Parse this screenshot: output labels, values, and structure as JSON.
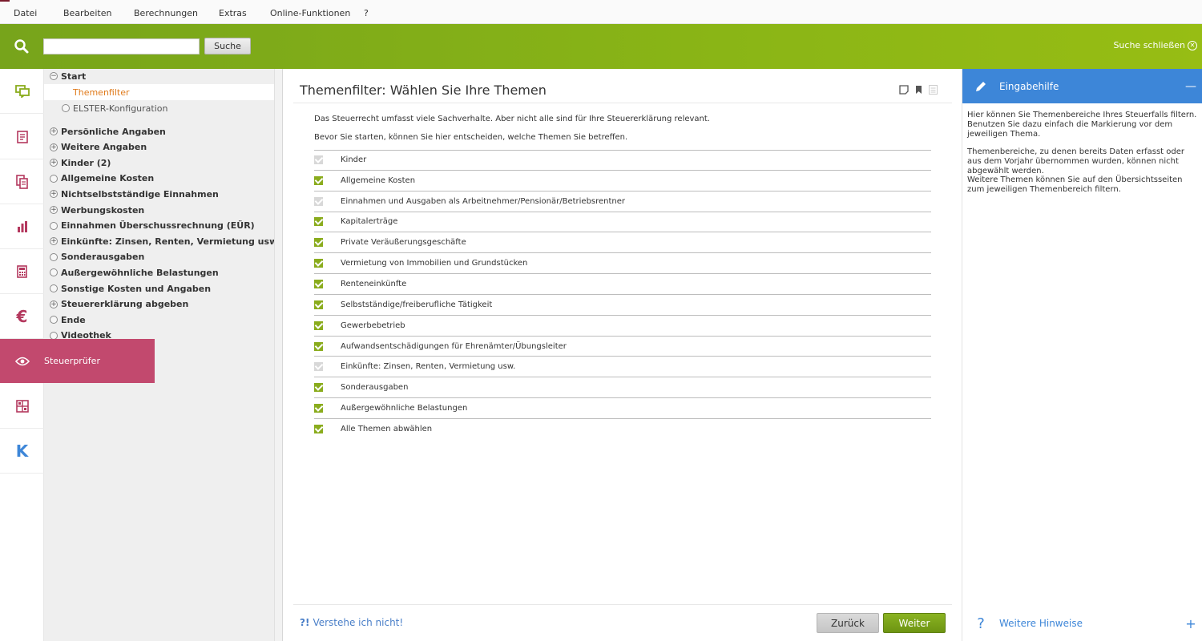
{
  "menu": [
    "Datei",
    "Bearbeiten",
    "Berechnungen",
    "Extras",
    "Online-Funktionen",
    "?"
  ],
  "search": {
    "placeholder": "",
    "button_label": "Suche",
    "close_label": "Suche schließen"
  },
  "side_icons": [
    {
      "icon": "chat-icon",
      "color": "#8aac1d"
    },
    {
      "icon": "form-icon",
      "color": "#b4385e"
    },
    {
      "icon": "documents-icon",
      "color": "#b4385e"
    },
    {
      "icon": "bar-chart-icon",
      "color": "#b4385e"
    },
    {
      "icon": "calculator-icon",
      "color": "#b4385e"
    },
    {
      "icon": "euro-icon",
      "color": "#b4385e"
    },
    {
      "icon": "eye-icon",
      "color": "#ffffff"
    },
    {
      "icon": "dashboard-icon",
      "color": "#b4385e"
    },
    {
      "icon": "k-logo-icon",
      "color": "#3d86d8"
    }
  ],
  "steuerpruefer_label": "Steuerprüfer",
  "tree": {
    "start": "Start",
    "children": [
      "Themenfilter",
      "ELSTER-Konfiguration"
    ],
    "sections": [
      {
        "label": "Persönliche Angaben",
        "sym": "+"
      },
      {
        "label": "Weitere Angaben",
        "sym": "+"
      },
      {
        "label": "Kinder (2)",
        "sym": "+"
      },
      {
        "label": "Allgemeine Kosten",
        "sym": ""
      },
      {
        "label": "Nichtselbstständige Einnahmen",
        "sym": "+"
      },
      {
        "label": "Werbungskosten",
        "sym": "+"
      },
      {
        "label": "Einnahmen Überschussrechnung (EÜR)",
        "sym": ""
      },
      {
        "label": "Einkünfte: Zinsen, Renten, Vermietung usw.",
        "sym": "+"
      },
      {
        "label": "Sonderausgaben",
        "sym": ""
      },
      {
        "label": "Außergewöhnliche Belastungen",
        "sym": ""
      },
      {
        "label": "Sonstige Kosten und Angaben",
        "sym": ""
      },
      {
        "label": "Steuererklärung abgeben",
        "sym": "+"
      },
      {
        "label": "Ende",
        "sym": ""
      },
      {
        "label": "Videothek",
        "sym": ""
      }
    ]
  },
  "main": {
    "title": "Themenfilter: Wählen Sie Ihre Themen",
    "intro1": "Das Steuerrecht umfasst viele Sachverhalte. Aber nicht alle sind für Ihre Steuererklärung relevant.",
    "intro2": "Bevor Sie starten, können Sie hier entscheiden, welche Themen Sie betreffen.",
    "topics": [
      {
        "label": "Kinder",
        "state": "gray"
      },
      {
        "label": "Allgemeine Kosten",
        "state": "green"
      },
      {
        "label": "Einnahmen und Ausgaben als Arbeitnehmer/Pensionär/Betriebsrentner",
        "state": "gray"
      },
      {
        "label": "Kapitalerträge",
        "state": "green"
      },
      {
        "label": "Private Veräußerungsgeschäfte",
        "state": "green"
      },
      {
        "label": "Vermietung von Immobilien und Grundstücken",
        "state": "green"
      },
      {
        "label": "Renteneinkünfte",
        "state": "green"
      },
      {
        "label": "Selbstständige/freiberufliche Tätigkeit",
        "state": "green"
      },
      {
        "label": "Gewerbebetrieb",
        "state": "green"
      },
      {
        "label": "Aufwandsentschädigungen für Ehrenämter/Übungsleiter",
        "state": "green"
      },
      {
        "label": "Einkünfte: Zinsen, Renten, Vermietung usw.",
        "state": "gray"
      },
      {
        "label": "Sonderausgaben",
        "state": "green"
      },
      {
        "label": "Außergewöhnliche Belastungen",
        "state": "green"
      },
      {
        "label": "Alle Themen abwählen",
        "state": "green"
      }
    ],
    "help_link_prefix": "?!",
    "help_link": "Verstehe ich nicht!",
    "back_label": "Zurück",
    "next_label": "Weiter"
  },
  "help_panel": {
    "title": "Eingabehilfe",
    "p1": "Hier können Sie Themenbereiche Ihres Steuerfalls filtern. Benutzen Sie dazu einfach die Markierung vor dem jeweiligen Thema.",
    "p2": "Themenbereiche, zu denen bereits Daten erfasst oder aus dem Vorjahr übernommen wurden, können nicht abgewählt werden.",
    "p3": "Weitere Themen können Sie auf den Übersichtsseiten zum jeweiligen Themenbereich filtern.",
    "more_label": "Weitere Hinweise"
  },
  "colors": {
    "accent_green": "#8aac1d",
    "accent_red": "#c2496e",
    "accent_blue": "#3d86d8",
    "tree_selected": "#e07b1c"
  }
}
